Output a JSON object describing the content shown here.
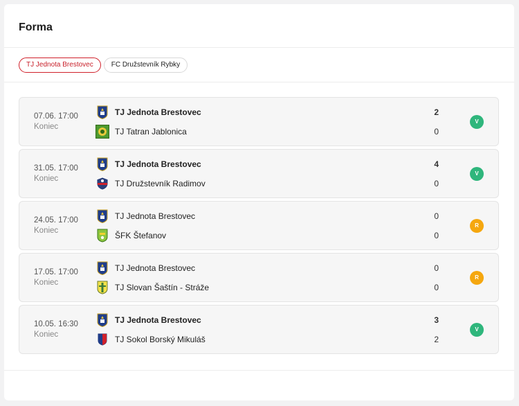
{
  "widget": {
    "title": "Forma"
  },
  "tabs": [
    {
      "label": "TJ Jednota Brestovec",
      "active": true
    },
    {
      "label": "FC Družstevník Rybky",
      "active": false
    }
  ],
  "colors": {
    "win": "#2fb67c",
    "draw": "#f5a70f",
    "accent": "#d0212b"
  },
  "matches": [
    {
      "date": "07.06. 17:00",
      "status": "Koniec",
      "home": {
        "name": "TJ Jednota Brestovec",
        "logo": "brestovec-crest-icon",
        "winner": true
      },
      "away": {
        "name": "TJ Tatran Jablonica",
        "logo": "jablonica-crest-icon",
        "winner": false
      },
      "home_score": "2",
      "away_score": "0",
      "result": "V",
      "result_kind": "win"
    },
    {
      "date": "31.05. 17:00",
      "status": "Koniec",
      "home": {
        "name": "TJ Jednota Brestovec",
        "logo": "brestovec-crest-icon",
        "winner": true
      },
      "away": {
        "name": "TJ Družstevník Radimov",
        "logo": "radimov-crest-icon",
        "winner": false
      },
      "home_score": "4",
      "away_score": "0",
      "result": "V",
      "result_kind": "win"
    },
    {
      "date": "24.05. 17:00",
      "status": "Koniec",
      "home": {
        "name": "TJ Jednota Brestovec",
        "logo": "brestovec-crest-icon",
        "winner": false
      },
      "away": {
        "name": "ŠFK Štefanov",
        "logo": "stefanov-crest-icon",
        "winner": false
      },
      "home_score": "0",
      "away_score": "0",
      "result": "R",
      "result_kind": "draw"
    },
    {
      "date": "17.05. 17:00",
      "status": "Koniec",
      "home": {
        "name": "TJ Jednota Brestovec",
        "logo": "brestovec-crest-icon",
        "winner": false
      },
      "away": {
        "name": "TJ Slovan Šaštín - Stráže",
        "logo": "sastin-crest-icon",
        "winner": false
      },
      "home_score": "0",
      "away_score": "0",
      "result": "R",
      "result_kind": "draw"
    },
    {
      "date": "10.05. 16:30",
      "status": "Koniec",
      "home": {
        "name": "TJ Jednota Brestovec",
        "logo": "brestovec-crest-icon",
        "winner": true
      },
      "away": {
        "name": "TJ Sokol Borský Mikuláš",
        "logo": "borsky-mikulas-crest-icon",
        "winner": false
      },
      "home_score": "3",
      "away_score": "2",
      "result": "V",
      "result_kind": "win"
    }
  ]
}
